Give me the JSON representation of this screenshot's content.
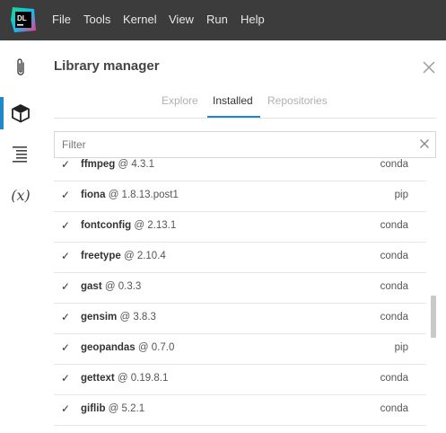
{
  "app": {
    "logo_text": "DL"
  },
  "menu": [
    "File",
    "Tools",
    "Kernel",
    "View",
    "Run",
    "Help"
  ],
  "panel": {
    "title": "Library manager"
  },
  "tabs": [
    {
      "label": "Explore",
      "active": false
    },
    {
      "label": "Installed",
      "active": true
    },
    {
      "label": "Repositories",
      "active": false
    }
  ],
  "filter": {
    "label": "Filter"
  },
  "packages": [
    {
      "name": "ffmpeg",
      "version": "@ 4.3.1",
      "source": "conda"
    },
    {
      "name": "fiona",
      "version": "@ 1.8.13.post1",
      "source": "pip"
    },
    {
      "name": "fontconfig",
      "version": "@ 2.13.1",
      "source": "conda"
    },
    {
      "name": "freetype",
      "version": "@ 2.10.4",
      "source": "conda"
    },
    {
      "name": "gast",
      "version": "@ 0.3.3",
      "source": "conda"
    },
    {
      "name": "gensim",
      "version": "@ 3.8.3",
      "source": "conda"
    },
    {
      "name": "geopandas",
      "version": "@ 0.7.0",
      "source": "pip"
    },
    {
      "name": "gettext",
      "version": "@ 0.19.8.1",
      "source": "conda"
    },
    {
      "name": "giflib",
      "version": "@ 5.2.1",
      "source": "conda"
    }
  ],
  "check_glyph": "✓",
  "colors": {
    "menubar": "#3c3c3c",
    "accent": "#1e88c8"
  }
}
